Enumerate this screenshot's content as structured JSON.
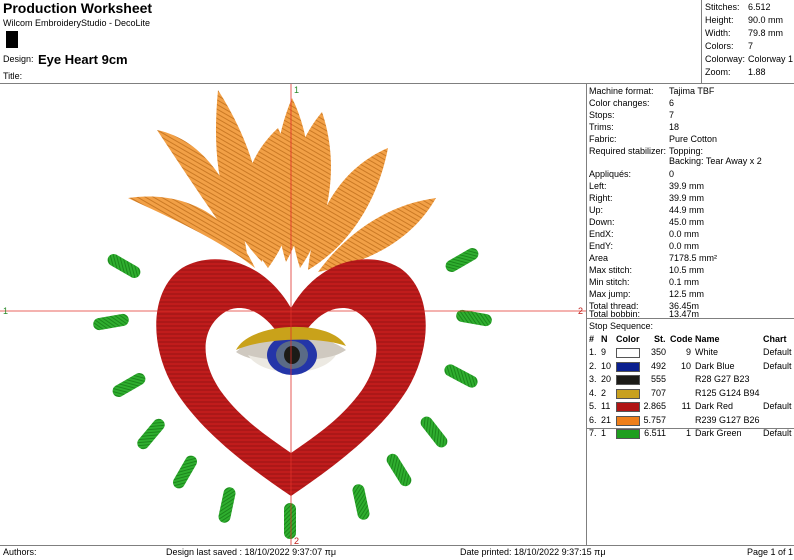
{
  "header": {
    "title": "Production Worksheet",
    "software": "Wilcom EmbroideryStudio - DecoLite",
    "design_label": "Design:",
    "design_name": "Eye Heart 9cm",
    "title_label": "Title:"
  },
  "summary": [
    {
      "label": "Stitches:",
      "value": "6.512"
    },
    {
      "label": "Height:",
      "value": "90.0 mm"
    },
    {
      "label": "Width:",
      "value": "79.8 mm"
    },
    {
      "label": "Colors:",
      "value": "7"
    },
    {
      "label": "Colorway:",
      "value": "Colorway 1"
    },
    {
      "label": "Zoom:",
      "value": "1.88"
    }
  ],
  "details": [
    {
      "label": "Machine format:",
      "value": "Tajima TBF"
    },
    {
      "label": "Color changes:",
      "value": "6"
    },
    {
      "label": "Stops:",
      "value": "7"
    },
    {
      "label": "Trims:",
      "value": "18"
    },
    {
      "label": "Fabric:",
      "value": "Pure Cotton"
    },
    {
      "label": "Required stabilizer:",
      "value": "Topping:",
      "value2": "Backing: Tear Away x 2"
    },
    {
      "label": "Appliqués:",
      "value": "0"
    },
    {
      "label": "Left:",
      "value": "39.9 mm"
    },
    {
      "label": "Right:",
      "value": "39.9 mm"
    },
    {
      "label": "Up:",
      "value": "44.9 mm"
    },
    {
      "label": "Down:",
      "value": "45.0 mm"
    },
    {
      "label": "EndX:",
      "value": "0.0 mm"
    },
    {
      "label": "EndY:",
      "value": "0.0 mm"
    },
    {
      "label": "Area",
      "value": "7178.5 mm²"
    },
    {
      "label": "Max stitch:",
      "value": "10.5 mm"
    },
    {
      "label": "Min stitch:",
      "value": "0.1 mm"
    },
    {
      "label": "Max jump:",
      "value": "12.5 mm"
    },
    {
      "label": "Total thread:",
      "value": "36.45m"
    },
    {
      "label": "Total bobbin:",
      "value": "13.47m"
    }
  ],
  "stop_sequence": {
    "title": "Stop Sequence:",
    "headers": [
      "#",
      "N",
      "Color",
      "St.",
      "Code",
      "Name",
      "Chart"
    ],
    "rows": [
      {
        "num": "1.",
        "n": "9",
        "color": "#ffffff",
        "st": "350",
        "code": "9",
        "name": "White",
        "chart": "Default"
      },
      {
        "num": "2.",
        "n": "10",
        "color": "#0a1f8f",
        "st": "492",
        "code": "10",
        "name": "Dark Blue",
        "chart": "Default"
      },
      {
        "num": "3.",
        "n": "20",
        "color": "#1c1b17",
        "st": "555",
        "code": "",
        "name": "R28 G27 B23",
        "chart": ""
      },
      {
        "num": "4.",
        "n": "2",
        "color": "#c8a01e",
        "st": "707",
        "code": "",
        "name": "R125 G124 B94",
        "chart": ""
      },
      {
        "num": "5.",
        "n": "11",
        "color": "#b01414",
        "st": "2.865",
        "code": "11",
        "name": "Dark Red",
        "chart": "Default"
      },
      {
        "num": "6.",
        "n": "21",
        "color": "#ef7f1a",
        "st": "5.757",
        "code": "",
        "name": "R239 G127 B26",
        "chart": ""
      },
      {
        "num": "7.",
        "n": "1",
        "color": "#1e9e1e",
        "st": "6.511",
        "code": "1",
        "name": "Dark Green",
        "chart": "Default"
      }
    ]
  },
  "canvas": {
    "axis_labels": {
      "left": "1",
      "right": "2",
      "top": "1",
      "bottom": "2"
    }
  },
  "footer": {
    "authors": "Authors:",
    "design_saved": "Design last saved : 18/10/2022 9:37:07 πμ",
    "date_printed": "Date printed: 18/10/2022 9:37:15 πμ",
    "page": "Page 1 of 1"
  }
}
